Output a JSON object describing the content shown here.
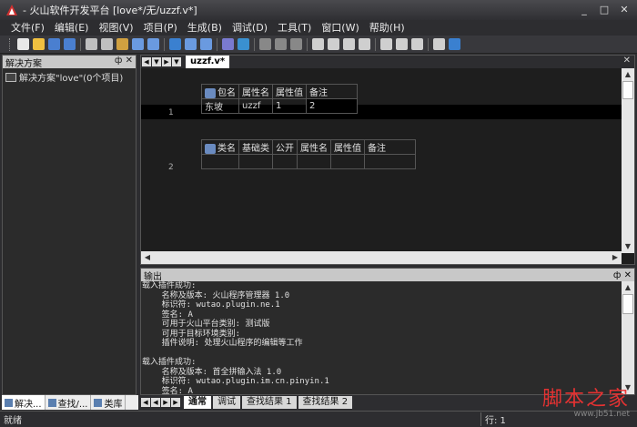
{
  "window": {
    "title": "- 火山软件开发平台 [love*/无/uzzf.v*]",
    "minimize": "_",
    "maximize": "□",
    "close": "✕"
  },
  "menu": [
    "文件(F)",
    "编辑(E)",
    "视图(V)",
    "项目(P)",
    "生成(B)",
    "调试(D)",
    "工具(T)",
    "窗口(W)",
    "帮助(H)"
  ],
  "toolbar_icons": [
    "new-file-icon",
    "open-icon",
    "save-icon",
    "save-all-icon",
    "sep",
    "cut-icon",
    "copy-icon",
    "paste-icon",
    "undo-icon",
    "redo-icon",
    "sep",
    "find-icon",
    "back-icon",
    "forward-icon",
    "sep",
    "build-icon",
    "help-icon",
    "sep",
    "run-icon",
    "stop-icon",
    "debug-icon",
    "sep",
    "step-icon",
    "step-into-icon",
    "step-out-icon",
    "breakpoint-icon",
    "sep",
    "format-icon",
    "indent-icon",
    "outdent-icon",
    "sep",
    "window-icon",
    "zoom-icon"
  ],
  "solution_pane": {
    "title": "解决方案",
    "pin": "ф",
    "close": "✕",
    "root_label": "解决方案\"love\"(0个项目)"
  },
  "left_tabs": [
    "解决...",
    "查找/...",
    "类库"
  ],
  "editor": {
    "nav": [
      "◀",
      "▼",
      "▶",
      "▼"
    ],
    "doc_tab": "uzzf.v*",
    "close": "✕",
    "line1": "1",
    "line2": "2",
    "package_table": {
      "headers": [
        "包名",
        "属性名",
        "属性值",
        "备注"
      ],
      "row": [
        "东坡",
        "uzzf",
        "1",
        "2"
      ]
    },
    "class_table": {
      "headers": [
        "类名",
        "基础类",
        "公开",
        "属性名",
        "属性值",
        "备注"
      ],
      "row": [
        "",
        "",
        "",
        "",
        "",
        ""
      ]
    }
  },
  "output": {
    "title": "输出",
    "pin": "ф",
    "close": "✕",
    "text": "载入插件成功:\n    名称及版本: 火山程序管理器 1.0\n    标识符: wutao.plugin.ne.1\n    签名: A\n    可用于火山平台类别: 测试版\n    可用于目标环境类别:\n    插件说明: 处理火山程序的编辑等工作\n\n载入插件成功:\n    名称及版本: 首全拼输入法 1.0\n    标识符: wutao.plugin.im.cn.pinyin.1\n    签名: A\n    可用于火山平台类别: 测试版"
  },
  "bottom_tabs": [
    "通常",
    "调试",
    "查找结果 1",
    "查找结果 2"
  ],
  "status": {
    "left": "就绪",
    "line": "行: 1"
  },
  "watermark": {
    "text": "脚本之家",
    "url": "www.jb51.net"
  }
}
